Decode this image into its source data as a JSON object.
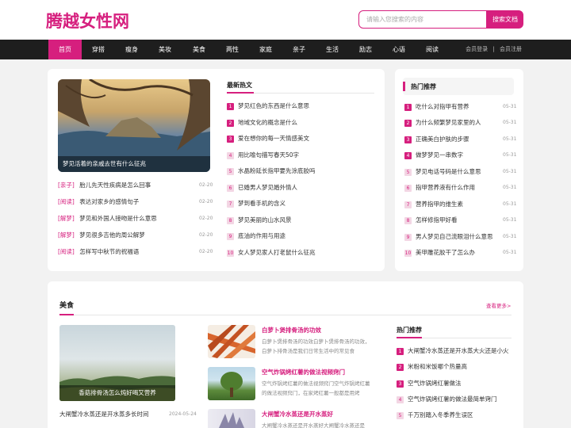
{
  "header": {
    "logo": "腾越女性网",
    "search_placeholder": "请输入您搜索的内容",
    "search_button": "搜索文档"
  },
  "nav": {
    "items": [
      "首页",
      "穿搭",
      "瘦身",
      "美妆",
      "美食",
      "两性",
      "家庭",
      "亲子",
      "生活",
      "励志",
      "心语",
      "阅读"
    ],
    "active_index": 0,
    "login": "会员登录",
    "separator": "|",
    "register": "会员注册"
  },
  "featured": {
    "caption": "梦见活着的亲戚去世有什么征兆"
  },
  "tagged_list": [
    {
      "tag": "[亲子]",
      "title": "胎儿先天性疾病是怎么回事",
      "date": "02-20"
    },
    {
      "tag": "[阅读]",
      "title": "表达对家乡的感情句子",
      "date": "02-20"
    },
    {
      "tag": "[解梦]",
      "title": "梦见和外国人接吻是什么意思",
      "date": "02-20"
    },
    {
      "tag": "[解梦]",
      "title": "梦见很多吉他的周公解梦",
      "date": "02-20"
    },
    {
      "tag": "[阅读]",
      "title": "怎样写中秋节的祝福语",
      "date": "02-20"
    }
  ],
  "latest": {
    "title": "最新热文",
    "items": [
      "梦见红色的东西是什么意思",
      "地域文化的概念是什么",
      "爱在想你的每一天情感美文",
      "用比喻句描写春天50字",
      "水晶粉延长指甲要先涂底胶吗",
      "已婚男人梦见婚外情人",
      "梦到看手机的含义",
      "梦见美丽的山水风景",
      "底油的作用与用途",
      "女人梦见家人打老鼠什么征兆"
    ]
  },
  "hot": {
    "title": "热门推荐",
    "items": [
      {
        "title": "吃什么对指甲有营养",
        "date": "05-31"
      },
      {
        "title": "为什么频繁梦见家里的人",
        "date": "05-31"
      },
      {
        "title": "正确美白护肤的步骤",
        "date": "05-31"
      },
      {
        "title": "做梦梦见一串数字",
        "date": "05-31"
      },
      {
        "title": "梦见电话号码是什么意思",
        "date": "05-31"
      },
      {
        "title": "指甲营养液有什么作用",
        "date": "05-31"
      },
      {
        "title": "营养指甲的维生素",
        "date": "05-31"
      },
      {
        "title": "怎样修指甲好看",
        "date": "05-31"
      },
      {
        "title": "男人梦见自己流眼泪什么意思",
        "date": "05-31"
      },
      {
        "title": "美甲雕花胶干了怎么办",
        "date": "05-31"
      }
    ]
  },
  "food": {
    "title": "美食",
    "more": "查看更多>",
    "image_caption": "香菇排骨汤怎么炖好喝又营养",
    "bottom_item": {
      "title": "大闸蟹冷水蒸还是开水蒸多长时间",
      "date": "2024-05-24"
    },
    "articles": [
      {
        "title": "白萝卜煲排骨汤的功效",
        "desc": "白萝卜煲排骨汤的功效白萝卜煲排骨汤的功效，白萝卜排骨汤是我们日常生活中的常见食"
      },
      {
        "title": "空气炸锅烤红薯的做法视频窍门",
        "desc": "空气炸锅烤红薯的做法视频窍门空气炸锅烤红薯的做法视频窍门，在家烤红薯一般都是用烤"
      },
      {
        "title": "大闸蟹冷水蒸还是开水蒸好",
        "desc": "大闸蟹冷水蒸还是开水蒸好大闸蟹冷水蒸还是"
      }
    ],
    "hot_title": "热门推荐",
    "hot_items": [
      "大闸蟹冷水蒸还是开水蒸大火还是小火",
      "米粉和米饭哪个热量高",
      "空气炸锅烤红薯做法",
      "空气炸锅烤红薯的做法最简单窍门",
      "千万别踏入冬季养生误区"
    ]
  }
}
